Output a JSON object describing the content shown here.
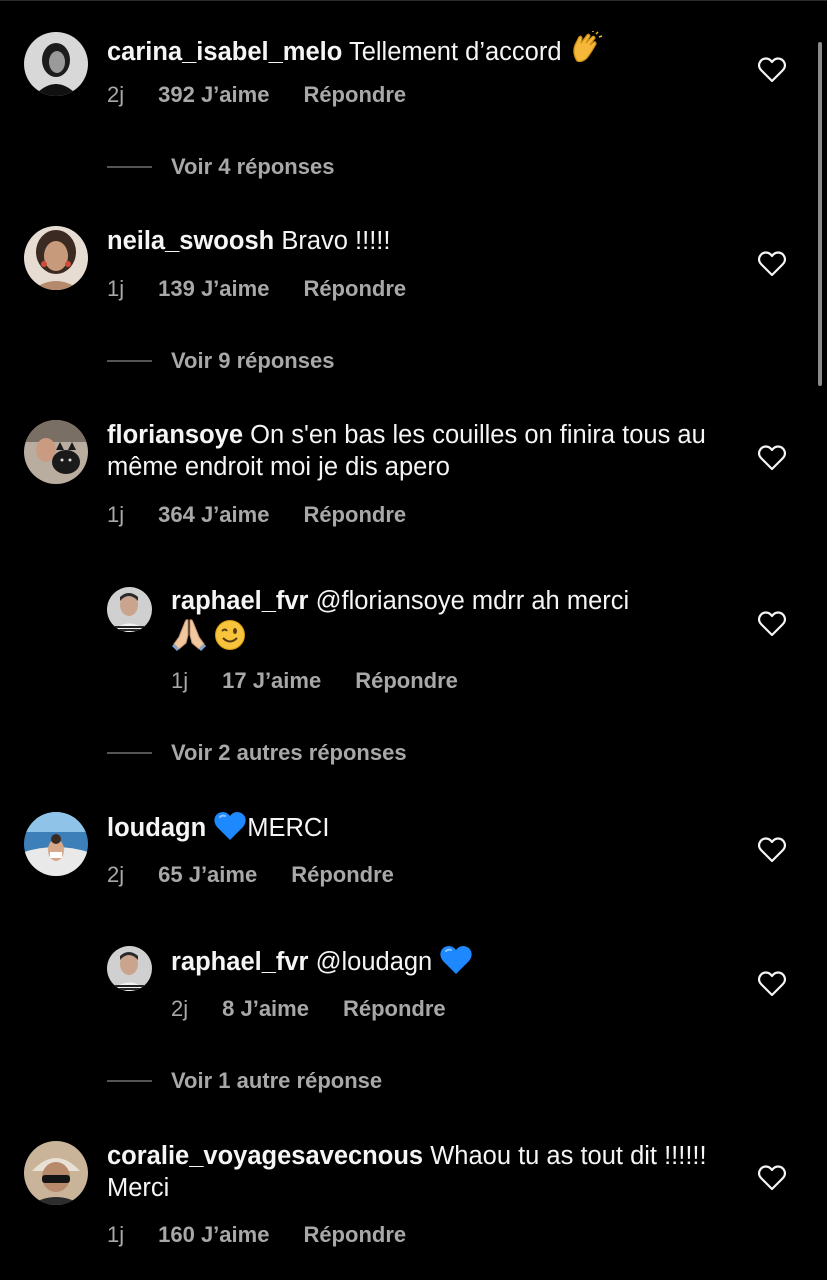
{
  "colors": {
    "background": "#000000",
    "text_primary": "#f5f5f5",
    "text_secondary": "#a8a8a8",
    "heart_emoji": "#1e88ff"
  },
  "comments": [
    {
      "username": "carina_isabel_melo",
      "text": "Tellement d’accord",
      "emoji": "clapping-hands",
      "time": "2j",
      "likes": "392 J’aime",
      "reply": "Répondre",
      "view_replies": "Voir 4 réponses"
    },
    {
      "username": "neila_swoosh",
      "text": "Bravo !!!!!",
      "time": "1j",
      "likes": "139 J’aime",
      "reply": "Répondre",
      "view_replies": "Voir 9 réponses"
    },
    {
      "username": "floriansoye",
      "text": "On s'en bas les couilles on finira tous au même endroit moi je dis apero",
      "time": "1j",
      "likes": "364 J’aime",
      "reply": "Répondre",
      "replies": [
        {
          "username": "raphael_fvr",
          "text": "@floriansoye mdrr ah merci",
          "emojis": [
            "folded-hands",
            "winking-face"
          ],
          "time": "1j",
          "likes": "17 J’aime",
          "reply": "Répondre"
        }
      ],
      "view_replies": "Voir 2 autres réponses"
    },
    {
      "username": "loudagn",
      "text": "MERCI",
      "emoji": "blue-heart",
      "time": "2j",
      "likes": "65 J’aime",
      "reply": "Répondre",
      "replies": [
        {
          "username": "raphael_fvr",
          "text": "@loudagn",
          "emojis": [
            "blue-heart"
          ],
          "time": "2j",
          "likes": "8 J’aime",
          "reply": "Répondre"
        }
      ],
      "view_replies": "Voir 1 autre réponse"
    },
    {
      "username": "coralie_voyagesavecnous",
      "text": "Whaou tu as tout dit !!!!!! Merci",
      "time": "1j",
      "likes": "160 J’aime",
      "reply": "Répondre"
    }
  ]
}
